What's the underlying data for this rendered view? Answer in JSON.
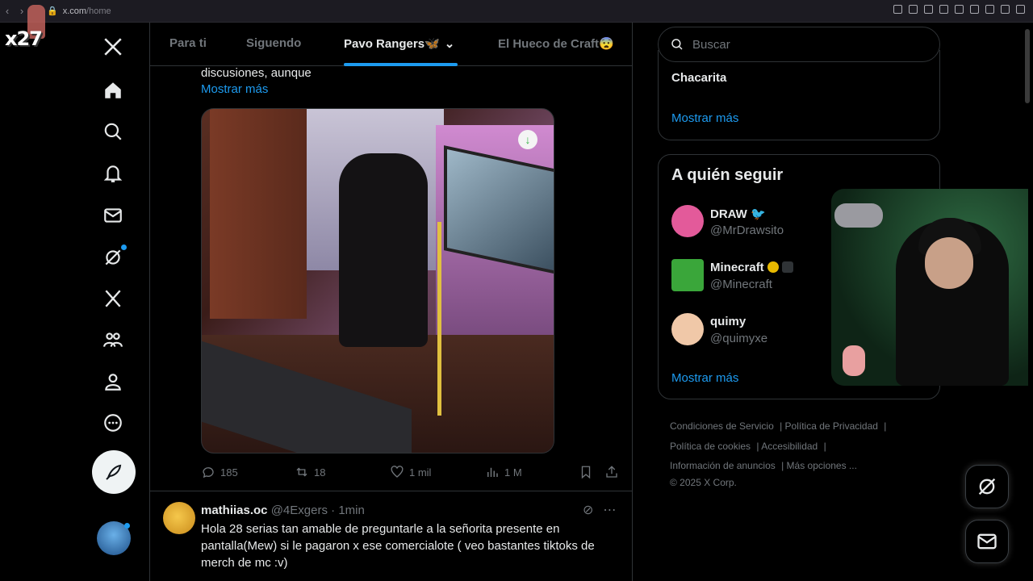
{
  "browser": {
    "url_host": "x.com",
    "url_path": "/home"
  },
  "overlay": {
    "label": "x27"
  },
  "nav": {
    "items": [
      "x-logo-icon",
      "home-icon",
      "explore-icon",
      "notifications-icon",
      "messages-icon",
      "grok-icon",
      "premium-icon",
      "communities-icon",
      "profile-icon",
      "more-icon"
    ]
  },
  "tabs": {
    "for_you": "Para ti",
    "following": "Siguendo",
    "pavo": "Pavo Rangers🦋",
    "hueco": "El Hueco de Craft😨"
  },
  "tweet": {
    "line_top": "discusiones, aunque",
    "show_more": "Mostrar más",
    "replies": "185",
    "retweets": "18",
    "likes": "1 mil",
    "views": "1 M"
  },
  "reply": {
    "name": "mathiias.oc",
    "handle": "@4Exgers",
    "sep": "·",
    "time": "1min",
    "text": "Hola 28 serias tan amable de preguntarle a la señorita presente en pantalla(Mew) si le pagaron x ese comercialote ( veo bastantes tiktoks de merch de mc :v)"
  },
  "search": {
    "placeholder": "Buscar"
  },
  "trends": {
    "item": "Chacarita",
    "show_more": "Mostrar más"
  },
  "who_to_follow": {
    "title": "A quién seguir",
    "users": [
      {
        "name": "DRAW",
        "handle": "@MrDrawsito",
        "color": "#e35a9a"
      },
      {
        "name": "Minecraft",
        "handle": "@Minecraft",
        "color": "#3aa63a"
      },
      {
        "name": "quimy",
        "handle": "@quimyxe",
        "color": "#f0c8a8"
      }
    ],
    "show_more": "Mostrar más"
  },
  "footer": {
    "terms": "Condiciones de Servicio",
    "privacy": "Política de Privacidad",
    "cookies": "Política de cookies",
    "accessibility": "Accesibilidad",
    "ads": "Información de anuncios",
    "more": "Más opciones ...",
    "copyright": "© 2025 X Corp."
  },
  "colors": {
    "accent": "#1d9bf0",
    "background": "#000000",
    "muted": "#71767b"
  }
}
